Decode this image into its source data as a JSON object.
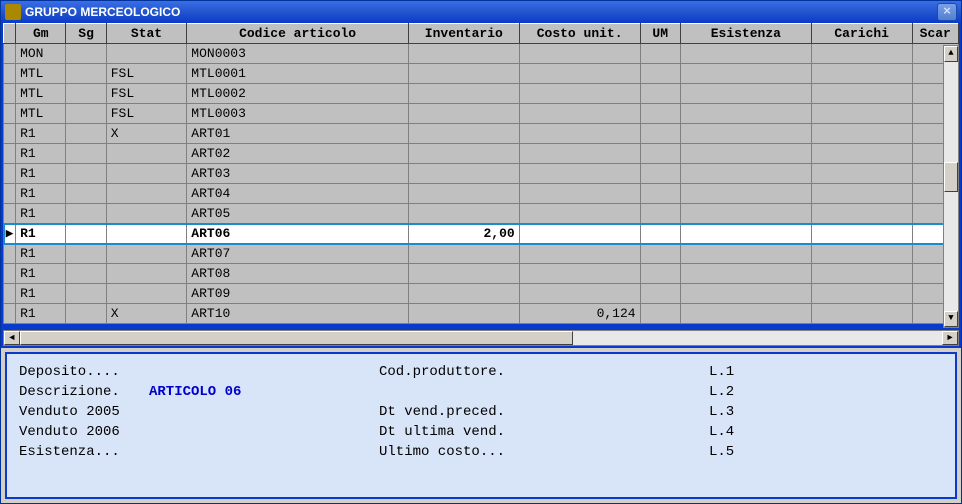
{
  "window": {
    "title": "GRUPPO MERCEOLOGICO"
  },
  "columns": {
    "marker": "",
    "gm": "Gm",
    "sg": "Sg",
    "stat": "Stat",
    "code": "Codice articolo",
    "inv": "Inventario",
    "costo": "Costo unit.",
    "um": "UM",
    "esist": "Esistenza",
    "carichi": "Carichi",
    "scar": "Scar"
  },
  "rows": [
    {
      "gm": "MON",
      "sg": "",
      "stat": "",
      "code": "MON0003",
      "inv": "",
      "costo": "",
      "um": "",
      "esist": "",
      "carichi": ""
    },
    {
      "gm": "MTL",
      "sg": "",
      "stat": "FSL",
      "code": "MTL0001",
      "inv": "",
      "costo": "",
      "um": "",
      "esist": "",
      "carichi": ""
    },
    {
      "gm": "MTL",
      "sg": "",
      "stat": "FSL",
      "code": "MTL0002",
      "inv": "",
      "costo": "",
      "um": "",
      "esist": "",
      "carichi": ""
    },
    {
      "gm": "MTL",
      "sg": "",
      "stat": "FSL",
      "code": "MTL0003",
      "inv": "",
      "costo": "",
      "um": "",
      "esist": "",
      "carichi": ""
    },
    {
      "gm": "R1",
      "sg": "",
      "stat": "X",
      "code": "ART01",
      "inv": "",
      "costo": "",
      "um": "",
      "esist": "",
      "carichi": ""
    },
    {
      "gm": "R1",
      "sg": "",
      "stat": "",
      "code": "ART02",
      "inv": "",
      "costo": "",
      "um": "",
      "esist": "",
      "carichi": ""
    },
    {
      "gm": "R1",
      "sg": "",
      "stat": "",
      "code": "ART03",
      "inv": "",
      "costo": "",
      "um": "",
      "esist": "",
      "carichi": ""
    },
    {
      "gm": "R1",
      "sg": "",
      "stat": "",
      "code": "ART04",
      "inv": "",
      "costo": "",
      "um": "",
      "esist": "",
      "carichi": ""
    },
    {
      "gm": "R1",
      "sg": "",
      "stat": "",
      "code": "ART05",
      "inv": "",
      "costo": "",
      "um": "",
      "esist": "",
      "carichi": ""
    },
    {
      "gm": "R1",
      "sg": "",
      "stat": "",
      "code": "ART06",
      "inv": "2,00",
      "costo": "",
      "um": "",
      "esist": "",
      "carichi": "",
      "selected": true
    },
    {
      "gm": "R1",
      "sg": "",
      "stat": "",
      "code": "ART07",
      "inv": "",
      "costo": "",
      "um": "",
      "esist": "",
      "carichi": ""
    },
    {
      "gm": "R1",
      "sg": "",
      "stat": "",
      "code": "ART08",
      "inv": "",
      "costo": "",
      "um": "",
      "esist": "",
      "carichi": ""
    },
    {
      "gm": "R1",
      "sg": "",
      "stat": "",
      "code": "ART09",
      "inv": "",
      "costo": "",
      "um": "",
      "esist": "",
      "carichi": ""
    },
    {
      "gm": "R1",
      "sg": "",
      "stat": "X",
      "code": "ART10",
      "inv": "",
      "costo": "0,124",
      "um": "",
      "esist": "",
      "carichi": ""
    }
  ],
  "detail": {
    "labels": {
      "deposito": "Deposito....",
      "descrizione": "Descrizione.",
      "venduto1": "Venduto 2005",
      "venduto2": "Venduto 2006",
      "esistenza": "Esistenza...",
      "codprod": "Cod.produttore.",
      "dtprec": "Dt vend.preced.",
      "dtult": "Dt ultima vend.",
      "ultcosto": "Ultimo costo...",
      "l1": "L.1",
      "l2": "L.2",
      "l3": "L.3",
      "l4": "L.4",
      "l5": "L.5"
    },
    "values": {
      "descrizione": "ARTICOLO 06"
    }
  }
}
